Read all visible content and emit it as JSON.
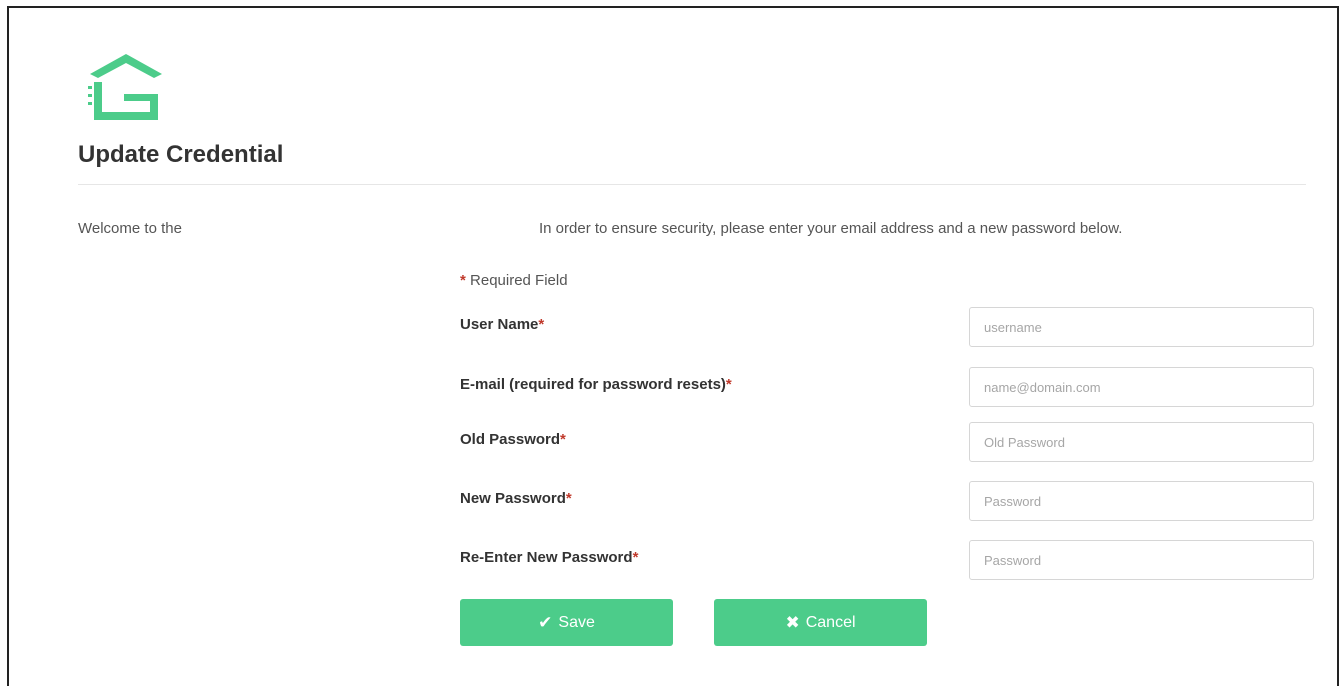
{
  "header": {
    "title": "Update Credential"
  },
  "intro": {
    "welcome": "Welcome to the",
    "security_message": "In order to ensure security, please enter your email address and a new password below."
  },
  "form": {
    "required_note": "Required Field",
    "required_marker": "*",
    "fields": [
      {
        "label": "User Name",
        "placeholder": "username"
      },
      {
        "label": "E-mail (required for password resets)",
        "placeholder": "name@domain.com"
      },
      {
        "label": "Old Password",
        "placeholder": "Old Password"
      },
      {
        "label": "New Password",
        "placeholder": "Password"
      },
      {
        "label": "Re-Enter New Password",
        "placeholder": "Password"
      }
    ]
  },
  "buttons": {
    "save_label": "Save",
    "cancel_label": "Cancel"
  },
  "colors": {
    "accent": "#4ccc8a",
    "required_star": "#c0392b"
  },
  "icons": {
    "logo": "house-g-logo-icon",
    "save": "check-icon",
    "cancel": "close-icon"
  }
}
